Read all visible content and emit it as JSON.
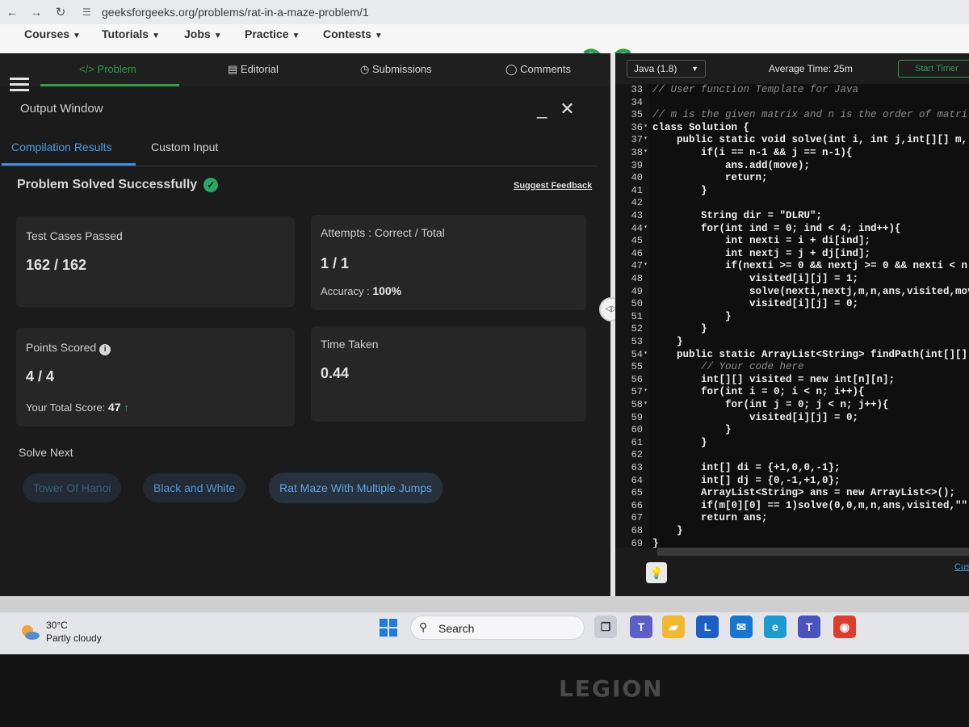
{
  "browser": {
    "url": "geeksforgeeks.org/problems/rat-in-a-maze-problem/1"
  },
  "site_nav": {
    "items": [
      "Courses",
      "Tutorials",
      "Jobs",
      "Practice",
      "Contests"
    ]
  },
  "problem_tabs": [
    {
      "label": "Problem",
      "icon": "code-icon",
      "active": true
    },
    {
      "label": "Editorial",
      "icon": "document-icon",
      "active": false
    },
    {
      "label": "Submissions",
      "icon": "clock-icon",
      "active": false
    },
    {
      "label": "Comments",
      "icon": "comment-icon",
      "active": false
    }
  ],
  "output_window": {
    "title": "Output Window",
    "minimize": "_",
    "close": "✕",
    "subtabs": [
      "Compilation Results",
      "Custom Input"
    ],
    "status": "Problem Solved Successfully",
    "feedback_link": "Suggest Feedback",
    "cards": {
      "test_cases": {
        "label": "Test Cases Passed",
        "value": "162 / 162"
      },
      "attempts": {
        "label": "Attempts : Correct / Total",
        "value": "1 / 1",
        "accuracy_label": "Accuracy :",
        "accuracy_value": "100%"
      },
      "points": {
        "label": "Points Scored",
        "value": "4 / 4",
        "total_label": "Your Total Score:",
        "total_value": "47"
      },
      "time": {
        "label": "Time Taken",
        "value": "0.44"
      }
    },
    "solve_next": {
      "label": "Solve Next",
      "problems": [
        "Tower Of Hanoi",
        "Black and White",
        "Rat Maze With Multiple Jumps"
      ]
    }
  },
  "editor": {
    "language": "Java (1.8)",
    "avg_time": "Average Time: 25m",
    "timer_button": "Start Timer",
    "footer_link": "Cus",
    "lines": [
      {
        "n": "33",
        "t": "// User function Template for Java",
        "c": true
      },
      {
        "n": "34",
        "t": ""
      },
      {
        "n": "35",
        "t": "// m is the given matrix and n is the order of matri",
        "c": true
      },
      {
        "n": "36",
        "t": "class Solution {",
        "fold": true
      },
      {
        "n": "37",
        "t": "    public static void solve(int i, int j,int[][] m, ",
        "fold": true
      },
      {
        "n": "38",
        "t": "        if(i == n-1 && j == n-1){",
        "fold": true
      },
      {
        "n": "39",
        "t": "            ans.add(move);"
      },
      {
        "n": "40",
        "t": "            return;"
      },
      {
        "n": "41",
        "t": "        }"
      },
      {
        "n": "42",
        "t": ""
      },
      {
        "n": "43",
        "t": "        String dir = \"DLRU\";"
      },
      {
        "n": "44",
        "t": "        for(int ind = 0; ind < 4; ind++){",
        "fold": true
      },
      {
        "n": "45",
        "t": "            int nexti = i + di[ind];"
      },
      {
        "n": "46",
        "t": "            int nextj = j + dj[ind];"
      },
      {
        "n": "47",
        "t": "            if(nexti >= 0 && nextj >= 0 && nexti < n",
        "fold": true
      },
      {
        "n": "48",
        "t": "                visited[i][j] = 1;"
      },
      {
        "n": "49",
        "t": "                solve(nexti,nextj,m,n,ans,visited,mov"
      },
      {
        "n": "50",
        "t": "                visited[i][j] = 0;"
      },
      {
        "n": "51",
        "t": "            }"
      },
      {
        "n": "52",
        "t": "        }"
      },
      {
        "n": "53",
        "t": "    }"
      },
      {
        "n": "54",
        "t": "    public static ArrayList<String> findPath(int[][]",
        "fold": true
      },
      {
        "n": "55",
        "t": "        // Your code here",
        "c": true
      },
      {
        "n": "56",
        "t": "        int[][] visited = new int[n][n];"
      },
      {
        "n": "57",
        "t": "        for(int i = 0; i < n; i++){",
        "fold": true
      },
      {
        "n": "58",
        "t": "            for(int j = 0; j < n; j++){",
        "fold": true
      },
      {
        "n": "59",
        "t": "                visited[i][j] = 0;"
      },
      {
        "n": "60",
        "t": "            }"
      },
      {
        "n": "61",
        "t": "        }"
      },
      {
        "n": "62",
        "t": ""
      },
      {
        "n": "63",
        "t": "        int[] di = {+1,0,0,-1};"
      },
      {
        "n": "64",
        "t": "        int[] dj = {0,-1,+1,0};"
      },
      {
        "n": "65",
        "t": "        ArrayList<String> ans = new ArrayList<>();"
      },
      {
        "n": "66",
        "t": "        if(m[0][0] == 1)solve(0,0,m,n,ans,visited,\"\""
      },
      {
        "n": "67",
        "t": "        return ans;"
      },
      {
        "n": "68",
        "t": "    }"
      },
      {
        "n": "69",
        "t": "}"
      }
    ]
  },
  "taskbar": {
    "temperature": "30°C",
    "condition": "Partly cloudy",
    "search": "Search",
    "apps": [
      "task-view",
      "teams",
      "file-explorer",
      "L",
      "mail",
      "edge",
      "teams-chat",
      "chrome"
    ]
  },
  "laptop_brand": "LEGION"
}
